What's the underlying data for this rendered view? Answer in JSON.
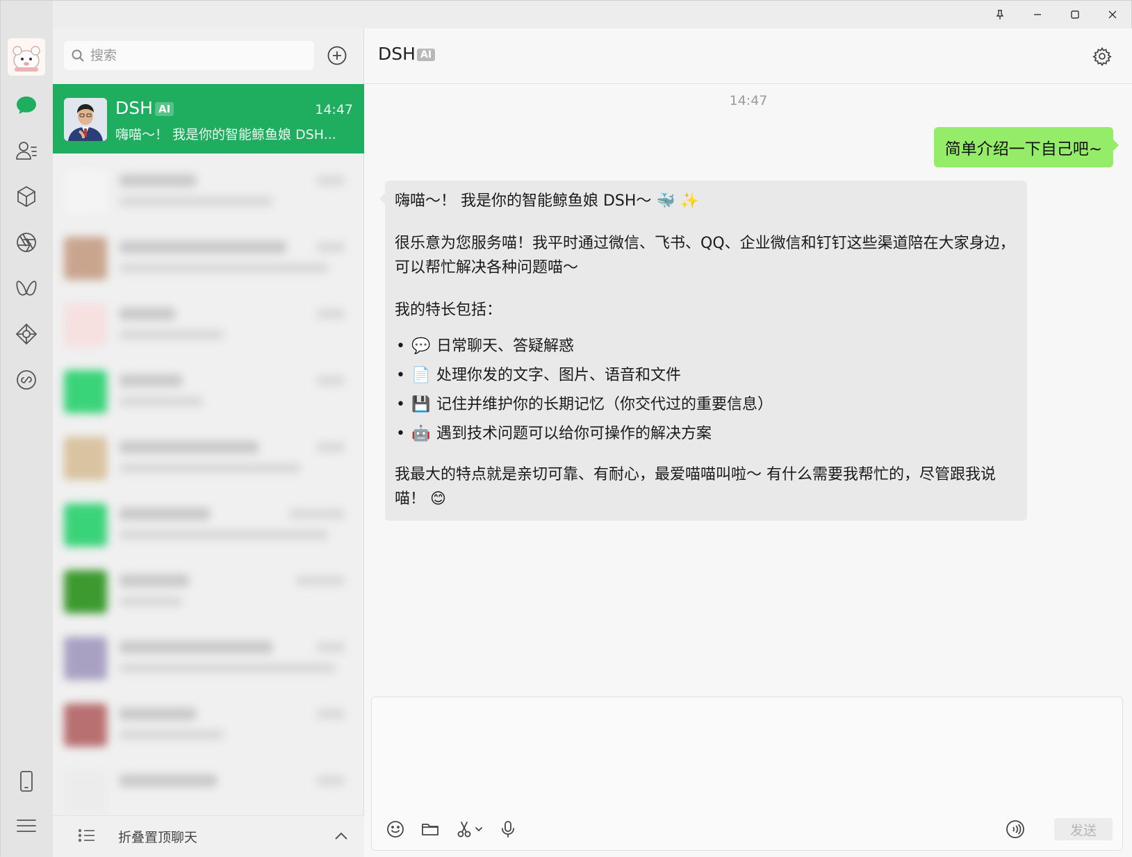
{
  "window": {
    "controls": [
      "pin-icon",
      "minimize-icon",
      "maximize-icon",
      "close-icon"
    ]
  },
  "rail": {
    "items": [
      {
        "name": "chats",
        "icon": "chat-bubble-icon",
        "active": true
      },
      {
        "name": "contacts",
        "icon": "contacts-icon"
      },
      {
        "name": "favorites",
        "icon": "cube-icon"
      },
      {
        "name": "moments",
        "icon": "aperture-icon"
      },
      {
        "name": "channels",
        "icon": "butterfly-icon"
      },
      {
        "name": "search",
        "icon": "diamond-icon"
      },
      {
        "name": "mini-programs",
        "icon": "link-circle-icon"
      }
    ],
    "bottom": [
      "phone-icon",
      "menu-icon"
    ]
  },
  "search": {
    "placeholder": "搜索"
  },
  "chat_list": {
    "active": {
      "name": "DSH",
      "badge": "AI",
      "time": "14:47",
      "preview": "嗨喵～！ 我是你的智能鲸鱼娘 DSH..."
    },
    "footer_label": "折叠置顶聊天"
  },
  "chat": {
    "title": "DSH",
    "badge": "AI",
    "timestamp": "14:47",
    "user_message": "简单介绍一下自己吧~",
    "bot_message": {
      "p1": "嗨喵～！ 我是你的智能鲸鱼娘 DSH～ 🐳 ✨",
      "p2": "很乐意为您服务喵！我平时通过微信、飞书、QQ、企业微信和钉钉这些渠道陪在大家身边，可以帮忙解决各种问题喵～",
      "p3": "我的特长包括：",
      "bullets": [
        {
          "emoji": "💬",
          "text": "日常聊天、答疑解惑"
        },
        {
          "emoji": "📄",
          "text": "处理你发的文字、图片、语音和文件"
        },
        {
          "emoji": "💾",
          "text": "记住并维护你的长期记忆（你交代过的重要信息）"
        },
        {
          "emoji": "🤖",
          "text": "遇到技术问题可以给你可操作的解决方案"
        }
      ],
      "p4": "我最大的特点就是亲切可靠、有耐心，最爱喵喵叫啦～ 有什么需要我帮忙的，尽管跟我说喵！ 😊"
    }
  },
  "composer": {
    "tools": [
      "emoji-icon",
      "folder-icon",
      "scissors-icon",
      "microphone-icon"
    ],
    "send_label": "发送"
  },
  "colors": {
    "active_green": "#1fae5f",
    "bubble_green": "#95ec69",
    "bot_bubble": "#e9e9e9"
  }
}
